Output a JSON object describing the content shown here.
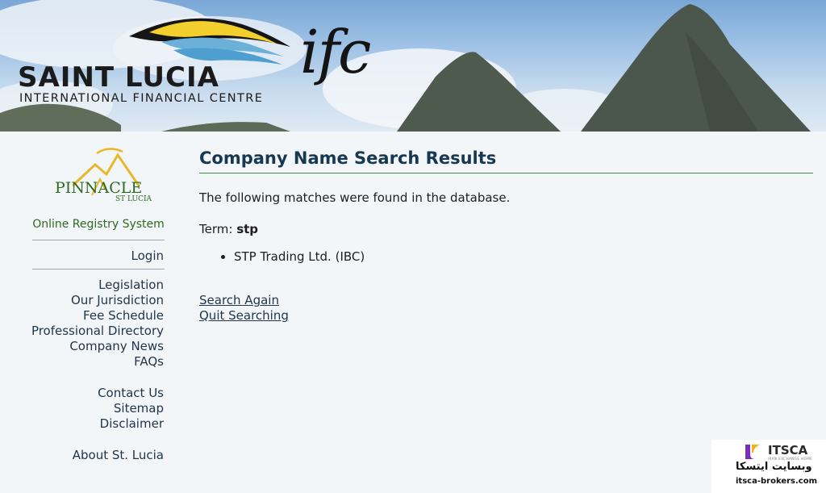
{
  "header": {
    "logo_title": "SAINT LUCIA",
    "logo_subtitle": "INTERNATIONAL FINANCIAL CENTRE",
    "logo_mark": "ifc"
  },
  "sidebar": {
    "brand": "PINNACLE",
    "brand_sub": "ST LUCIA",
    "registry_label": "Online Registry System",
    "login": "Login",
    "group1": [
      "Legislation",
      "Our Jurisdiction",
      "Fee Schedule",
      "Professional Directory",
      "Company News",
      "FAQs"
    ],
    "group2": [
      "Contact Us",
      "Sitemap",
      "Disclaimer"
    ],
    "group3": [
      "About St. Lucia"
    ]
  },
  "main": {
    "title": "Company Name Search Results",
    "intro": "The following matches were found in the database.",
    "term_label": "Term:",
    "term_value": "stp",
    "results": [
      "STP Trading Ltd. (IBC)"
    ],
    "search_again": "Search Again",
    "quit_searching": "Quit Searching"
  },
  "watermark": {
    "brand": "ITSCA",
    "tagline": "IRAN EXCHANGE HOME",
    "persian": "وبسایت ایتسکا",
    "url": "itsca-brokers.com"
  },
  "colors": {
    "heading": "#163850",
    "link": "#21364a",
    "accent_green": "#2d6a1f",
    "rule_green": "#3f8a3f",
    "background": "#f3f6f9"
  }
}
